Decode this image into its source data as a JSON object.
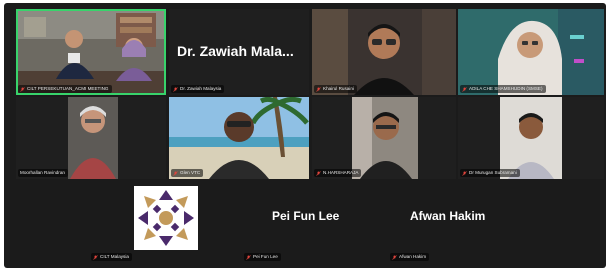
{
  "tiles": [
    {
      "name": "CILT PERSEKUTUAN_ACMI MEETING",
      "kind": "video",
      "active": true
    },
    {
      "name": "Dr. Zawiah Malaysia",
      "kind": "name",
      "display": "Dr. Zawiah Mala..."
    },
    {
      "name": "Khairul Rusaini",
      "kind": "video"
    },
    {
      "name": "ADILA CHE SHAMSHUDIN (SMSE)",
      "kind": "video"
    },
    {
      "name": "Moorhallan Ravindran",
      "kind": "video"
    },
    {
      "name": "Glen VTC",
      "kind": "video"
    },
    {
      "name": "N.HARSHARAJA",
      "kind": "video"
    },
    {
      "name": "Dr Murugan Subramani",
      "kind": "video"
    },
    {
      "name": "CILT Malaysia",
      "kind": "logo"
    },
    {
      "name": "Pei Fun Lee",
      "kind": "name",
      "display": "Pei Fun Lee"
    },
    {
      "name": "Afwan Hakim",
      "kind": "name",
      "display": "Afwan Hakim"
    }
  ],
  "colors": {
    "background": "#1b1b1b",
    "tile": "#262626",
    "active_speaker": "#38d36b",
    "muted_icon": "#e0443c",
    "logo_purple": "#4a2a6b",
    "logo_gold": "#c39a5a"
  },
  "icons": {
    "mic_muted": "mic-muted-icon",
    "logo": "cilt-logo-icon"
  }
}
